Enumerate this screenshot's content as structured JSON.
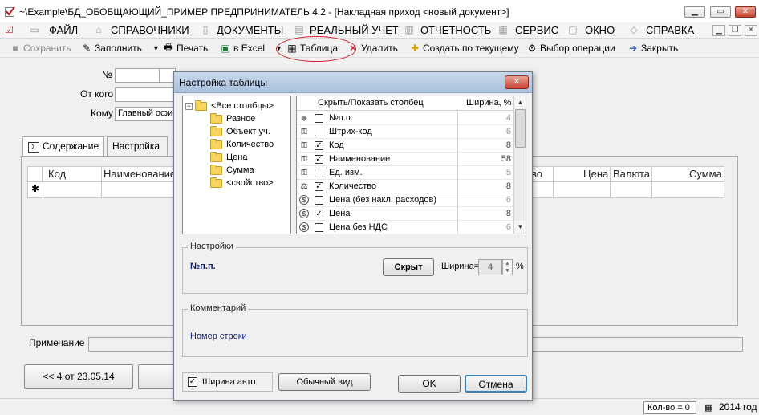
{
  "window": {
    "title": "~\\Example\\БД_ОБОБЩАЮЩИЙ_ПРИМЕР  ПРЕДПРИНИМАТЕЛЬ 4.2 - [Накладная приход <новый документ>]"
  },
  "menu": {
    "items": [
      "ФАЙЛ",
      "СПРАВОЧНИКИ",
      "ДОКУМЕНТЫ",
      "РЕАЛЬНЫЙ УЧЕТ",
      "ОТЧЕТНОСТЬ",
      "СЕРВИС",
      "ОКНО",
      "СПРАВКА"
    ]
  },
  "toolbar": {
    "save": "Сохранить",
    "fill": "Заполнить",
    "print": "Печать",
    "excel": "в Excel",
    "table": "Таблица",
    "delete": "Удалить",
    "create_from_current": "Создать по текущему",
    "select_operation": "Выбор операции",
    "close": "Закрыть"
  },
  "form": {
    "number_label": "№",
    "from_label": "От кого",
    "to_label": "Кому",
    "to_value": "Главный офис"
  },
  "tabs": [
    "Содержание",
    "Настройка"
  ],
  "grid": {
    "columns": [
      "Код",
      "Наименование",
      "во",
      "Цена",
      "Валюта",
      "Сумма"
    ],
    "new_row_marker": "✱"
  },
  "notes_label": "Примечание",
  "nav": {
    "prev": "<< 4 от 23.05.14"
  },
  "status": {
    "count": "Кол-во = 0",
    "year": "2014 год"
  },
  "dialog": {
    "title": "Настройка таблицы",
    "tree": [
      {
        "label": "<Все столбцы>",
        "level": 0
      },
      {
        "label": "Разное",
        "level": 1
      },
      {
        "label": "Объект уч.",
        "level": 1
      },
      {
        "label": "Количество",
        "level": 1
      },
      {
        "label": "Цена",
        "level": 1
      },
      {
        "label": "Сумма",
        "level": 1
      },
      {
        "label": "<свойство>",
        "level": 1
      }
    ],
    "columns_header": {
      "name": "Скрыть/Показать столбец",
      "width": "Ширина, %"
    },
    "columns": [
      {
        "icon": "diamond-icon",
        "glyph": "◆",
        "checked": false,
        "name": "№п.п.",
        "width": "4",
        "width_dim": true
      },
      {
        "icon": "key-icon",
        "glyph": "⚿",
        "checked": false,
        "name": "Штрих-код",
        "width": "6",
        "width_dim": true
      },
      {
        "icon": "key-icon",
        "glyph": "⚿",
        "checked": true,
        "name": "Код",
        "width": "8",
        "width_dim": false
      },
      {
        "icon": "key-icon",
        "glyph": "⚿",
        "checked": true,
        "name": "Наименование",
        "width": "58",
        "width_dim": false
      },
      {
        "icon": "key-icon",
        "glyph": "⚿",
        "checked": false,
        "name": "Ед. изм.",
        "width": "5",
        "width_dim": true
      },
      {
        "icon": "scales-icon",
        "glyph": "⚖",
        "checked": true,
        "name": "Количество",
        "width": "8",
        "width_dim": false
      },
      {
        "icon": "coin-icon",
        "glyph": "$",
        "checked": false,
        "name": "Цена (без накл. расходов)",
        "width": "6",
        "width_dim": true
      },
      {
        "icon": "coin-icon",
        "glyph": "$",
        "checked": true,
        "name": "Цена",
        "width": "8",
        "width_dim": false
      },
      {
        "icon": "coin-icon",
        "glyph": "$",
        "checked": false,
        "name": "Цена без НДС",
        "width": "6",
        "width_dim": true
      }
    ],
    "settings": {
      "label": "Настройки",
      "selected": "№п.п.",
      "hidden_button": "Скрыт",
      "width_label": "Ширина=",
      "width_value": "4",
      "percent": "%"
    },
    "comment": {
      "label": "Комментарий",
      "text": "Номер строки"
    },
    "auto_width": {
      "label": "Ширина авто",
      "checked": true
    },
    "normal_view": "Обычный вид",
    "ok": "OK",
    "cancel": "Отмена"
  }
}
